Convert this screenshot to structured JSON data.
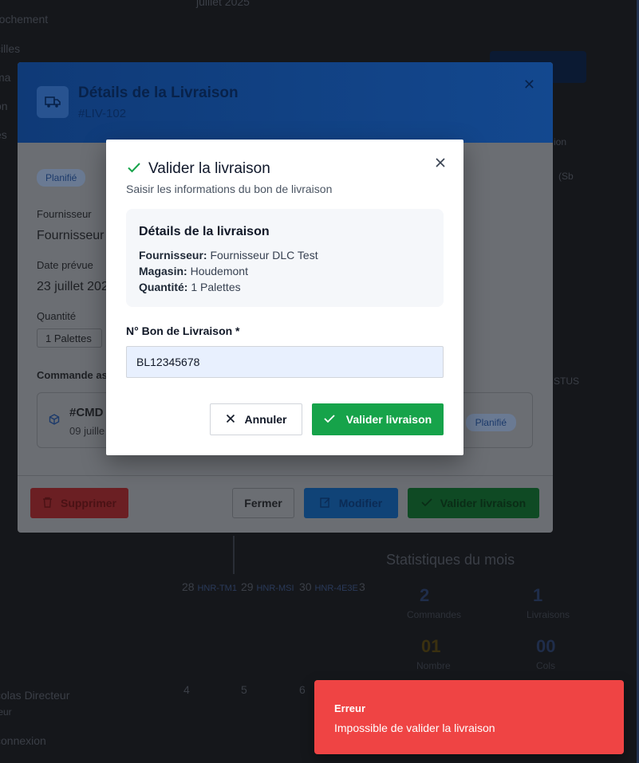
{
  "background": {
    "top_month": "juillet 2025",
    "sidebar_items": [
      "rochement",
      "cilles",
      "ma",
      "on",
      "es"
    ],
    "right_texts": [
      "ion",
      "(Sb",
      "STUS"
    ],
    "calendar": [
      {
        "day": "28",
        "label": "HNR-TM1"
      },
      {
        "day": "29",
        "label": "HNR-MSI"
      },
      {
        "day": "30",
        "label": "HNR-4E3E"
      },
      {
        "day": "3",
        "label": ""
      }
    ],
    "calendar_row2": [
      "4",
      "5",
      "6"
    ],
    "stats_title": "Statistiques du mois",
    "stats": [
      {
        "value": "2",
        "label": "Commandes"
      },
      {
        "value": "1",
        "label": "Livraisons"
      },
      {
        "value": "01",
        "label": "Nombre"
      },
      {
        "value": "00",
        "label": "Cols"
      }
    ],
    "user_name": "colas Directeur",
    "user_role": "teur",
    "logout": "connexion"
  },
  "details_modal": {
    "title": "Détails de la Livraison",
    "id": "#LIV-102",
    "status": "Planifié",
    "supplier_label": "Fournisseur",
    "supplier_value": "Fournisseur",
    "date_label": "Date prévue",
    "date_value": "23 juillet 202",
    "qty_label": "Quantité",
    "qty_value": "1 Palettes",
    "order_label": "Commande as",
    "order_id": "#CMD",
    "order_date": "09 juille",
    "order_status": "Planifié",
    "btn_delete": "Supprimer",
    "btn_close": "Fermer",
    "btn_edit": "Modifier",
    "btn_validate": "Valider livraison"
  },
  "validate_modal": {
    "title": "Valider la livraison",
    "subtitle": "Saisir les informations du bon de livraison",
    "info_title": "Détails de la livraison",
    "supplier_key": "Fournisseur:",
    "supplier_val": "Fournisseur DLC Test",
    "store_key": "Magasin:",
    "store_val": "Houdemont",
    "qty_key": "Quantité:",
    "qty_val": "1 Palettes",
    "field_label": "N° Bon de Livraison *",
    "field_value": "BL12345678",
    "btn_cancel": "Annuler",
    "btn_validate": "Valider livraison"
  },
  "toast": {
    "title": "Erreur",
    "message": "Impossible de valider la livraison"
  },
  "colors": {
    "success": "#16a34a",
    "error": "#ef4444",
    "primary": "#13488f"
  }
}
